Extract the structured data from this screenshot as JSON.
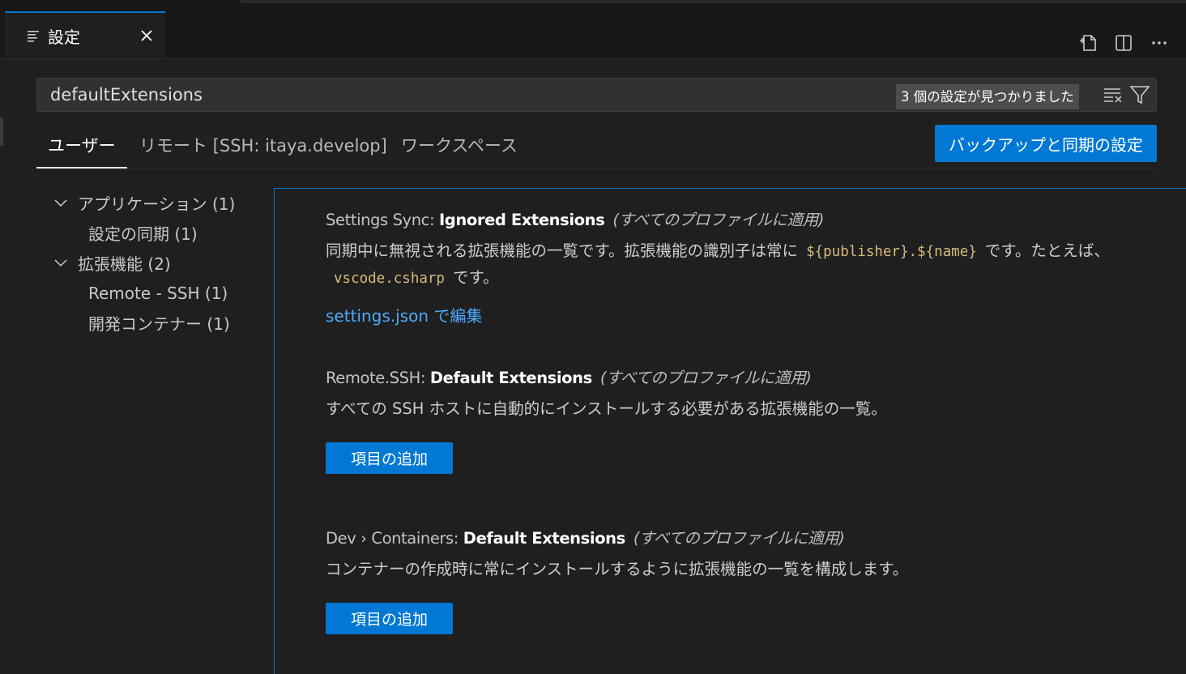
{
  "tab": {
    "title": "設定",
    "icon": "settings-lines-icon"
  },
  "actions": [
    {
      "name": "open-settings-json",
      "icon": "open-file-icon"
    },
    {
      "name": "split-editor",
      "icon": "split-editor-icon"
    },
    {
      "name": "more-actions",
      "icon": "ellipsis-icon"
    }
  ],
  "search": {
    "value": "defaultExtensions",
    "result_count": "3 個の設定が見つかりました"
  },
  "scopes": {
    "user": "ユーザー",
    "remote": "リモート [SSH: itaya.develop]",
    "workspace": "ワークスペース",
    "sync_button": "バックアップと同期の設定"
  },
  "toc": [
    {
      "label": "アプリケーション (1)",
      "level": 0,
      "expanded": true
    },
    {
      "label": "設定の同期 (1)",
      "level": 1
    },
    {
      "label": "拡張機能 (2)",
      "level": 0,
      "expanded": true
    },
    {
      "label": "Remote - SSH (1)",
      "level": 1
    },
    {
      "label": "開発コンテナー (1)",
      "level": 1
    }
  ],
  "settings": [
    {
      "category": "Settings Sync: ",
      "name": "Ignored Extensions",
      "scope_note": "(すべてのプロファイルに適用)",
      "desc_part1": "同期中に無視される拡張機能の一覧です。拡張機能の識別子は常に",
      "desc_code1": "${publisher}.${name}",
      "desc_part2": "です。たとえば、",
      "desc_code2": "vscode.csharp",
      "desc_part3": "です。",
      "link": "settings.json で編集"
    },
    {
      "category": "Remote.SSH: ",
      "name": "Default Extensions",
      "scope_note": "(すべてのプロファイルに適用)",
      "description": "すべての SSH ホストに自動的にインストールする必要がある拡張機能の一覧。",
      "button": "項目の追加"
    },
    {
      "category": "Dev › Containers: ",
      "name": "Default Extensions",
      "scope_note": "(すべてのプロファイルに適用)",
      "description": "コンテナーの作成時に常にインストールするように拡張機能の一覧を構成します。",
      "button": "項目の追加"
    }
  ],
  "colors": {
    "accent": "#0078d4",
    "link": "#4daafc",
    "code": "#d7ba7d",
    "background": "#1f1f1f"
  }
}
